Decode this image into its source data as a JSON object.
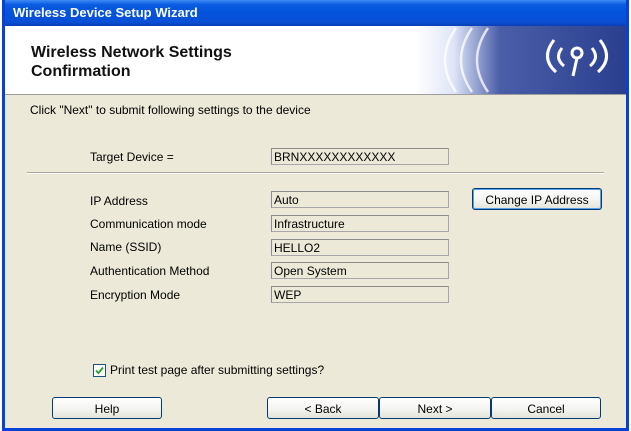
{
  "window": {
    "title": "Wireless Device Setup Wizard"
  },
  "header": {
    "title_line1": "Wireless Network Settings",
    "title_line2": "Confirmation",
    "art_icon": "wireless-signal-icon"
  },
  "instruction": "Click \"Next\" to submit following settings to the device",
  "target_device": {
    "label": "Target Device =",
    "value": "BRNXXXXXXXXXXXX"
  },
  "settings": [
    {
      "label": "IP Address",
      "value": "Auto"
    },
    {
      "label": "Communication mode",
      "value": "Infrastructure"
    },
    {
      "label": "Name (SSID)",
      "value": "HELLO2"
    },
    {
      "label": "Authentication Method",
      "value": "Open System"
    },
    {
      "label": "Encryption Mode",
      "value": "WEP"
    }
  ],
  "change_ip_button": {
    "label": "Change IP Address"
  },
  "print_test": {
    "checked": true,
    "label": "Print test page after submitting settings?"
  },
  "buttons": {
    "help": "Help",
    "back": "< Back",
    "next": "Next >",
    "cancel": "Cancel"
  },
  "colors": {
    "title_bar": "#0453dc",
    "dialog_bg": "#ece9d8",
    "header_art": "#2a3f8f"
  }
}
